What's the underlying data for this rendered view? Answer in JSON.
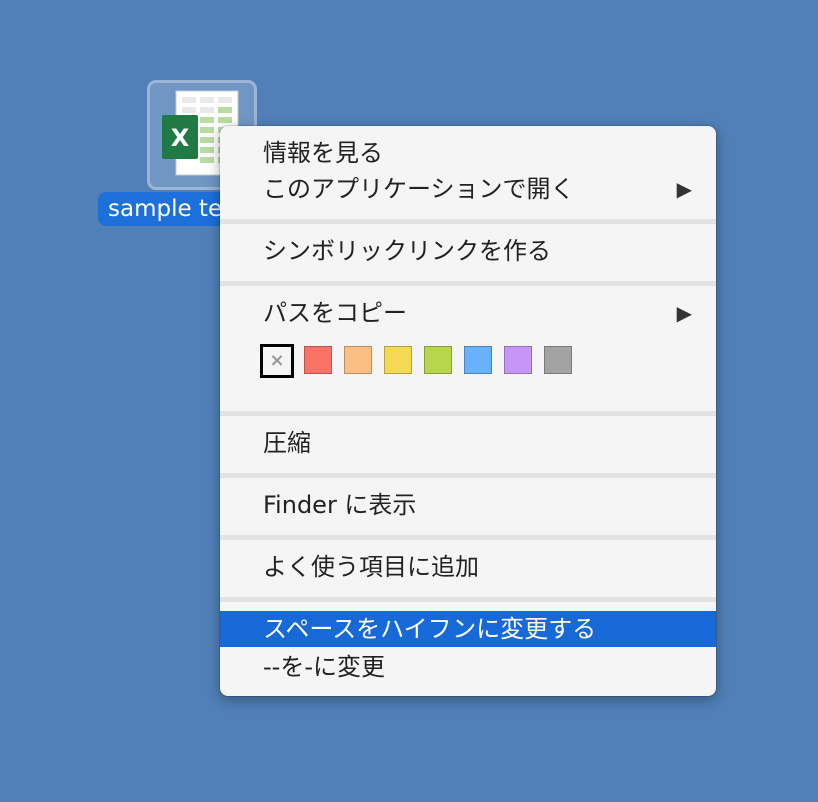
{
  "desktop": {
    "file": {
      "label": "sample te",
      "icon": "excel-file-icon",
      "badge_letter": "X"
    }
  },
  "context_menu": {
    "items": [
      {
        "label": "情報を見る"
      },
      {
        "label": "このアプリケーションで開く",
        "arrow": "▶"
      },
      {
        "label": "シンボリックリンクを作る"
      },
      {
        "label": "パスをコピー",
        "arrow": "▶"
      },
      {
        "label": "圧縮"
      },
      {
        "label": "Finder に表示"
      },
      {
        "label": "よく使う項目に追加"
      },
      {
        "label": "スペースをハイフンに変更する"
      },
      {
        "label": "--を-に変更"
      }
    ],
    "tags": {
      "none_glyph": "×",
      "colors": [
        "#fb7267",
        "#fbbf83",
        "#f4d952",
        "#b7d64b",
        "#68b1fb",
        "#c596f7",
        "#a3a3a3"
      ]
    },
    "highlight_color": "#1769d8"
  }
}
